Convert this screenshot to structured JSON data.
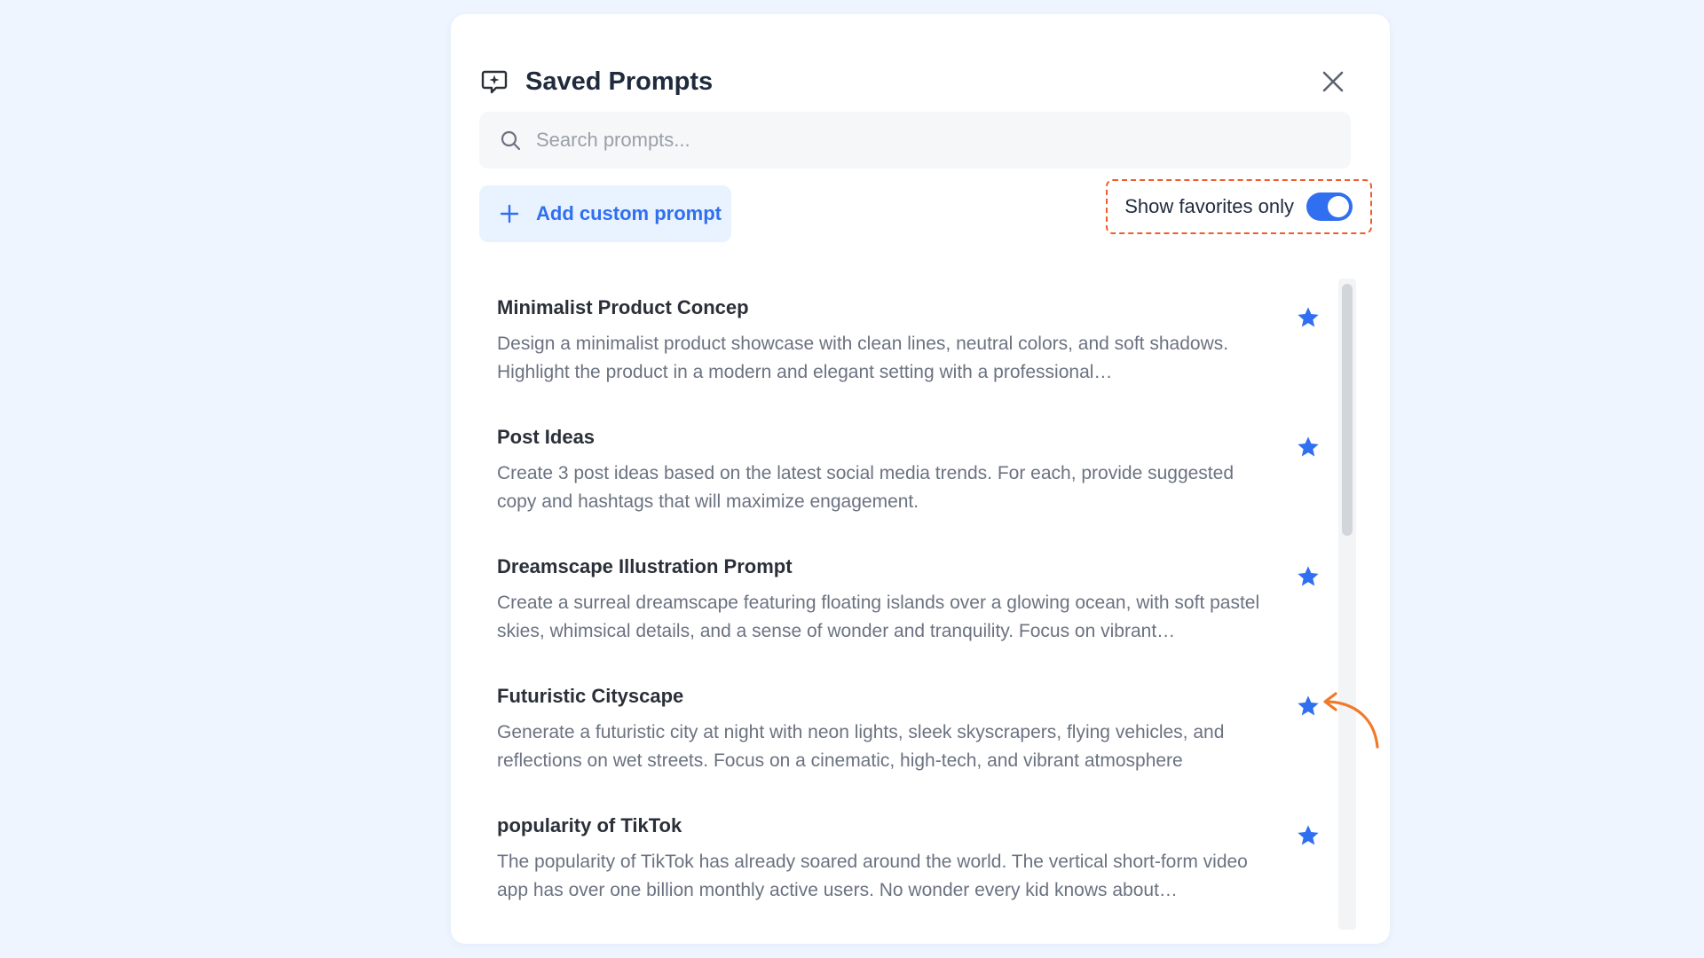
{
  "modal": {
    "title": "Saved Prompts",
    "close_icon": "close-icon",
    "header_icon": "chat-sparkle-icon"
  },
  "search": {
    "placeholder": "Search prompts...",
    "value": ""
  },
  "actions": {
    "add_label": "Add custom prompt",
    "favorites_label": "Show favorites only",
    "favorites_enabled": true
  },
  "colors": {
    "accent": "#2f6ff0",
    "highlight_border": "#ef5d2d",
    "annotation_arrow": "#f07a2a",
    "background": "#eef5ff"
  },
  "prompts": [
    {
      "title": "Minimalist Product Concep",
      "description": "Design a minimalist product showcase with clean lines, neutral colors, and soft shadows. Highlight the product in a modern and elegant setting with a professional…",
      "favorite": true
    },
    {
      "title": "Post Ideas",
      "description": "Create 3 post ideas based on the latest social media trends. For each, provide suggested copy and hashtags that will maximize engagement.",
      "favorite": true
    },
    {
      "title": "Dreamscape Illustration Prompt",
      "description": "Create a surreal dreamscape featuring floating islands over a glowing ocean, with soft pastel skies, whimsical details, and a sense of wonder and tranquility. Focus on vibrant…",
      "favorite": true
    },
    {
      "title": "Futuristic Cityscape",
      "description": "Generate a futuristic city at night with neon lights, sleek skyscrapers, flying vehicles, and reflections on wet streets. Focus on a cinematic, high-tech, and vibrant atmosphere",
      "favorite": true
    },
    {
      "title": "popularity of TikTok",
      "description": "The popularity of TikTok has already soared around the world. The vertical short-form video app has over one billion monthly active users. No wonder every kid knows about…",
      "favorite": true
    }
  ]
}
